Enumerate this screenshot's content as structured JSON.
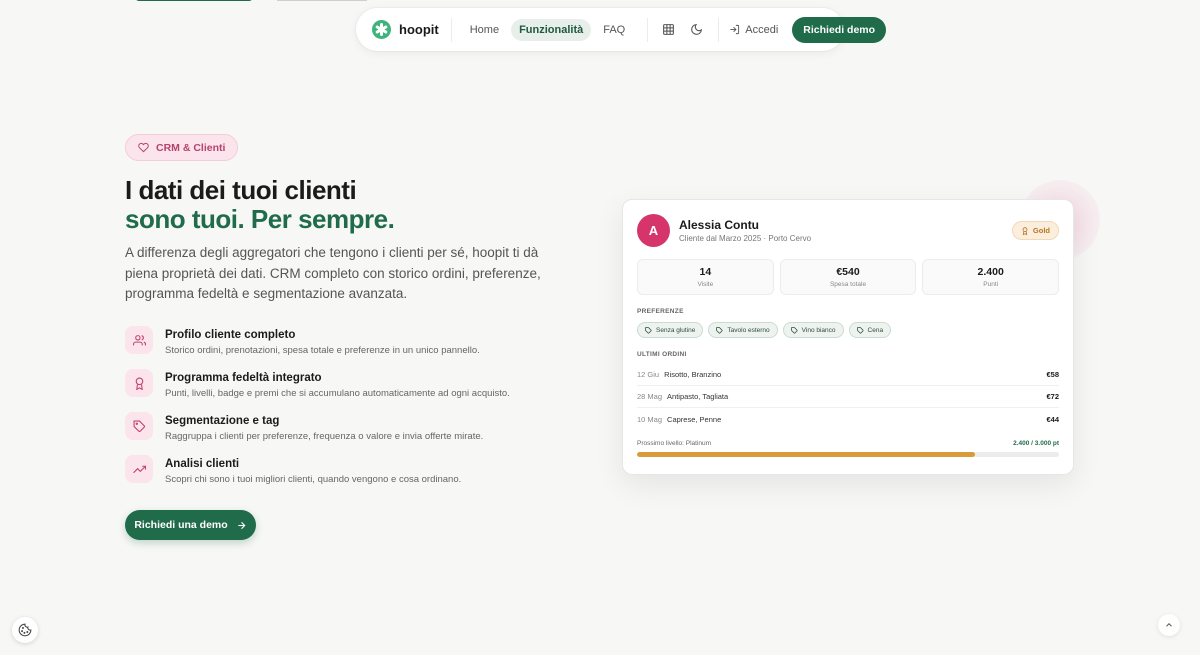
{
  "nav": {
    "brand": "hoopit",
    "links": [
      {
        "label": "Home"
      },
      {
        "label": "Funzionalità"
      },
      {
        "label": "FAQ"
      }
    ],
    "login_label": "Accedi",
    "demo_label": "Richiedi demo"
  },
  "hero": {
    "badge": "CRM & Clienti",
    "title_line1": "I dati dei tuoi clienti",
    "title_line2": "sono tuoi. Per sempre.",
    "lead": "A differenza degli aggregatori che tengono i clienti per sé, hoopit ti dà piena proprietà dei dati. CRM completo con storico ordini, preferenze, programma fedeltà e segmentazione avanzata.",
    "features": [
      {
        "icon": "users-icon",
        "title": "Profilo cliente completo",
        "desc": "Storico ordini, prenotazioni, spesa totale e preferenze in un unico pannello."
      },
      {
        "icon": "award-icon",
        "title": "Programma fedeltà integrato",
        "desc": "Punti, livelli, badge e premi che si accumulano automaticamente ad ogni acquisto."
      },
      {
        "icon": "tag-icon",
        "title": "Segmentazione e tag",
        "desc": "Raggruppa i clienti per preferenze, frequenza o valore e invia offerte mirate."
      },
      {
        "icon": "trending-up-icon",
        "title": "Analisi clienti",
        "desc": "Scopri chi sono i tuoi migliori clienti, quando vengono e cosa ordinano."
      }
    ],
    "cta_label": "Richiedi una demo"
  },
  "customer_card": {
    "avatar_initial": "A",
    "name": "Alessia Contu",
    "subtitle": "Cliente dal Marzo 2025 · Porto Cervo",
    "tier": "Gold",
    "stats": [
      {
        "value": "14",
        "label": "Visite"
      },
      {
        "value": "€540",
        "label": "Spesa totale"
      },
      {
        "value": "2.400",
        "label": "Punti"
      }
    ],
    "preferences_label": "PREFERENZE",
    "preferences": [
      "Senza glutine",
      "Tavolo esterno",
      "Vino bianco",
      "Cena"
    ],
    "orders_label": "ULTIMI ORDINI",
    "orders": [
      {
        "date": "12 Giu",
        "items": "Risotto, Branzino",
        "amount": "€58"
      },
      {
        "date": "28 Mag",
        "items": "Antipasto, Tagliata",
        "amount": "€72"
      },
      {
        "date": "10 Mag",
        "items": "Caprese, Penne",
        "amount": "€44"
      }
    ],
    "progress_label": "Prossimo livello: Platinum",
    "progress_value": "2.400 / 3.000 pt",
    "progress_fraction": 0.8
  },
  "colors": {
    "brand_green": "#1f6b4a",
    "accent_pink": "#d6356b",
    "gold": "#d99a3a"
  }
}
